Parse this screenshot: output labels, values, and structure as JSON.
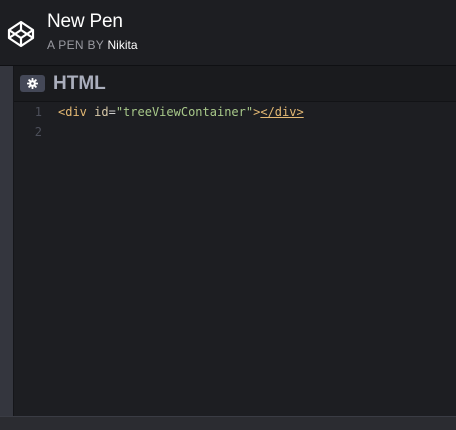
{
  "header": {
    "title": "New Pen",
    "byline_prefix": "A PEN BY",
    "author": "Nikita",
    "logo_icon": "codepen-logo-icon"
  },
  "editor": {
    "title": "HTML",
    "settings_icon": "gear-icon",
    "lines": [
      {
        "number": "1",
        "tokens": {
          "open_tag": "<div",
          "attr_name": " id",
          "equals": "=",
          "attr_value": "\"treeViewContainer\"",
          "open_end": ">",
          "close_tag": "</div>"
        }
      },
      {
        "number": "2"
      }
    ]
  },
  "colors": {
    "background": "#1d1e22",
    "tag": "#e3b873",
    "attribute": "#d7c8a8",
    "string": "#a8c98a",
    "line_number": "#4c4f5a",
    "editor_title": "#aaaebc"
  }
}
